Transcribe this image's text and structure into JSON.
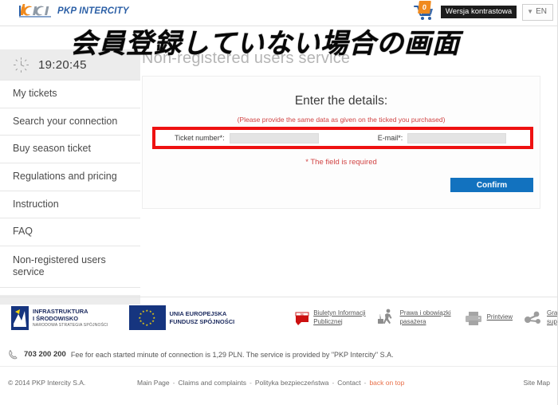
{
  "header": {
    "logo_text": "PKP INTERCITY",
    "logo_icon": "pkp-intercity-logo",
    "cart_icon": "shopping-cart-icon",
    "cart_count": "0",
    "contrast_label": "Wersja kontrastowa",
    "language": "EN",
    "chevron_icon": "chevron-down-icon"
  },
  "annotation": {
    "japanese_overlay": "会員登録していない場合の画面"
  },
  "page": {
    "title": "Non-registered users service"
  },
  "sidebar": {
    "clock_icon": "clock-icon",
    "time": "19:20:45",
    "items": [
      {
        "label": "My tickets"
      },
      {
        "label": "Search your connection"
      },
      {
        "label": "Buy season ticket"
      },
      {
        "label": "Regulations and pricing"
      },
      {
        "label": "Instruction"
      },
      {
        "label": "FAQ"
      },
      {
        "label": "Non-registered users service"
      }
    ]
  },
  "form": {
    "title": "Enter the details:",
    "hint": "(Please provide the same data as given on the ticked you purchased)",
    "ticket_label": "Ticket number*:",
    "ticket_value": "",
    "email_label": "E-mail*:",
    "email_value": "",
    "required_note": "* The field is required",
    "confirm_label": "Confirm"
  },
  "footer_logos": {
    "infrastructure": {
      "line1": "INFRASTRUKTURA",
      "line2": "I ŚRODOWISKO",
      "sub": "NARODOWA STRATEGIA SPÓJNOŚCI",
      "icon": "infrastructure-program-logo"
    },
    "eu": {
      "line1": "UNIA EUROPEJSKA",
      "line2": "FUNDUSZ SPÓJNOŚCI",
      "icon": "eu-flag-icon"
    },
    "links": [
      {
        "line1": "Biuletyn Informacji",
        "line2": "Publicznej",
        "icon": "bip-icon"
      },
      {
        "line1": "Prawa i obowiązki",
        "line2": "pasażera",
        "icon": "passenger-rights-icon"
      },
      {
        "line1": "Printview",
        "line2": "",
        "icon": "printer-icon"
      },
      {
        "line1": "Grant",
        "line2": "support",
        "icon": "grant-support-icon"
      }
    ]
  },
  "phone": {
    "icon": "phone-icon",
    "number": "703 200 200",
    "description": "Fee for each started minute of connection is 1,29 PLN. The service is provided by \"PKP Intercity\" S.A."
  },
  "bottom": {
    "copyright": "© 2014 PKP Intercity S.A.",
    "links": [
      {
        "label": "Main Page"
      },
      {
        "label": "Claims and complaints"
      },
      {
        "label": "Polityka bezpieczeństwa"
      },
      {
        "label": "Contact"
      }
    ],
    "separator": "-",
    "back_on_top": "back on top",
    "sitemap": "Site Map"
  },
  "colors": {
    "accent_blue": "#1272bf",
    "logo_blue": "#2b5fa6",
    "logo_orange": "#f08a1e",
    "alert_red": "#d14444",
    "annotation_red": "#ee1111",
    "eu_blue": "#16357f"
  }
}
